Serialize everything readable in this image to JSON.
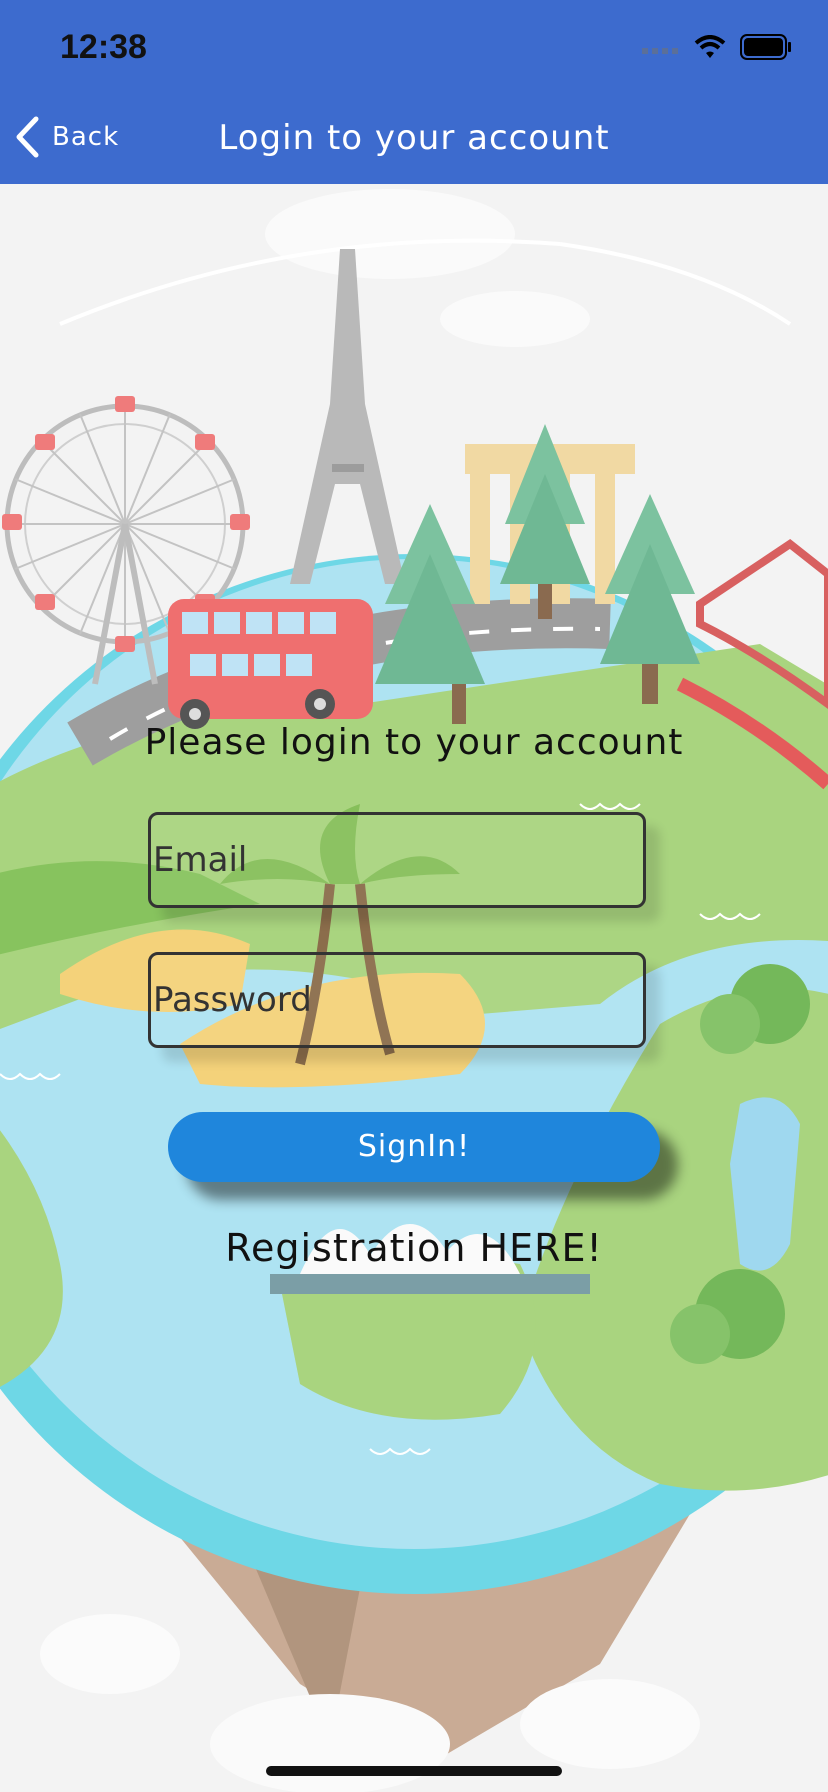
{
  "status_bar": {
    "time": "12:38"
  },
  "nav": {
    "back_label": "Back",
    "title": "Login to your account"
  },
  "form": {
    "heading": "Please login to your account",
    "email": {
      "placeholder": "Email",
      "value": ""
    },
    "password": {
      "placeholder": "Password",
      "value": ""
    },
    "signin_label": "SignIn!",
    "register_label": "Registration HERE!"
  },
  "colors": {
    "header": "#3d6bce",
    "button": "#1f86dc"
  }
}
